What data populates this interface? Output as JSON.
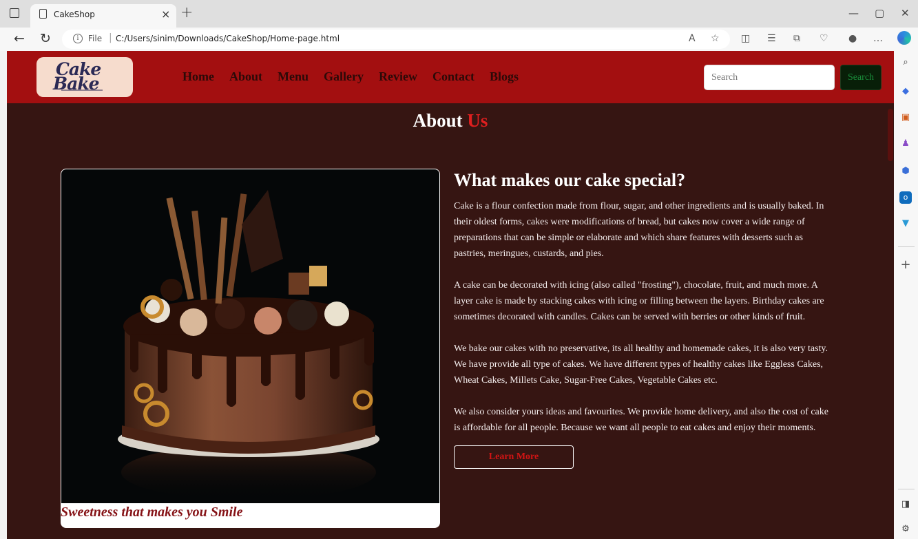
{
  "browser": {
    "tab_title": "CakeShop",
    "tab_close": "×",
    "new_tab": "+",
    "file_label": "File",
    "url": "C:/Users/sinim/Downloads/CakeShop/Home-page.html",
    "minimize": "—",
    "maximize": "▢",
    "close": "✕"
  },
  "site": {
    "logo_line1": "Cake",
    "logo_line2": "Bake",
    "nav": [
      "Home",
      "About",
      "Menu",
      "Gallery",
      "Review",
      "Contact",
      "Blogs"
    ],
    "search_placeholder": "Search",
    "search_button": "Search"
  },
  "about": {
    "heading_main": "About",
    "heading_accent": "Us",
    "image_caption": "Sweetness that makes you Smile",
    "subtitle": "What makes our cake special?",
    "paragraphs": [
      "Cake is a flour confection made from flour, sugar, and other ingredients and is usually baked. In their oldest forms, cakes were modifications of bread, but cakes now cover a wide range of preparations that can be simple or elaborate and which share features with desserts such as pastries, meringues, custards, and pies.",
      "A cake can be decorated with icing (also called \"frosting\"), chocolate, fruit, and much more. A layer cake is made by stacking cakes with icing or filling between the layers. Birthday cakes are sometimes decorated with candles. Cakes can be served with berries or other kinds of fruit.",
      "We bake our cakes with no preservative, its all healthy and homemade cakes, it is also very tasty. We have provide all type of cakes. We have different types of healthy cakes like Eggless Cakes, Wheat Cakes, Millets Cake, Sugar-Free Cakes, Vegetable Cakes etc.",
      "We also consider yours ideas and favourites. We provide home delivery, and also the cost of cake is affordable for all people. Because we want all people to eat cakes and enjoy their moments."
    ],
    "button": "Learn More"
  },
  "colors": {
    "navbar": "#a30f10",
    "page_background": "#361512",
    "accent_red": "#e01f1f",
    "caption": "#861317"
  }
}
